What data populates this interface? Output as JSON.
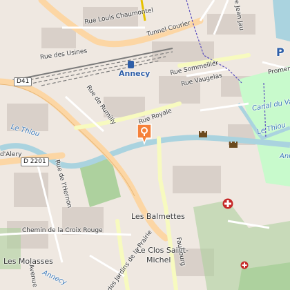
{
  "labels": {
    "rue_louis_chaumontel": "Rue Louis Chaumontel",
    "tunnel_courier": "Tunnel Courier",
    "rue_des_usines": "Rue des Usines",
    "annecy": "Annecy",
    "rue_sommeiller": "Rue Sommeiller",
    "rue_vaugelas": "Rue Vaugelas",
    "d41": "D41",
    "rue_de_rumilly": "Rue de Rumilly",
    "rue_royale": "Rue Royale",
    "le_thiou_left": "Le Thiou",
    "d_alery": "d'Alery",
    "d2201": "D 2201",
    "rue_de_l_hernon": "Rue de l'Hernon",
    "les_balmettes": "Les Balmettes",
    "chemin_croix_rouge": "Chemin de la Croix Rouge",
    "les_molasses": "Les Molasses",
    "le_clos_saint_michel_1": "Le Clos Saint-",
    "le_clos_saint_michel_2": "Michel",
    "rue_des_jardins_prairie": "Rue des Jardins de la Prairie",
    "canal_du_vasse": "Canal du Va",
    "le_thiou_right": "Le Thiou",
    "promena": "Promena",
    "avenue": "Avenue",
    "annecy_bottom": "Annecy",
    "faubourg": "Faubourg",
    "p_letter": "P",
    "rue_jean_jaures": "Rue Jean Jau",
    "ann": "Ann"
  },
  "colors": {
    "land": "#efe8e1",
    "building": "#d9d0c9",
    "water": "#aad3df",
    "park": "#c8facc",
    "grass": "#add19e",
    "major_road": "#fcd6a4",
    "secondary_road": "#f7fabf",
    "rail": "#7a7a7a",
    "marker": "#f5813a",
    "hospital": "#c62828",
    "boundary": "#5a4dbe"
  },
  "icons": {
    "location_marker": "map-pin-icon",
    "castle_1": "castle-icon",
    "castle_2": "castle-icon",
    "hospital": "hospital-icon",
    "train_station": "train-icon"
  }
}
